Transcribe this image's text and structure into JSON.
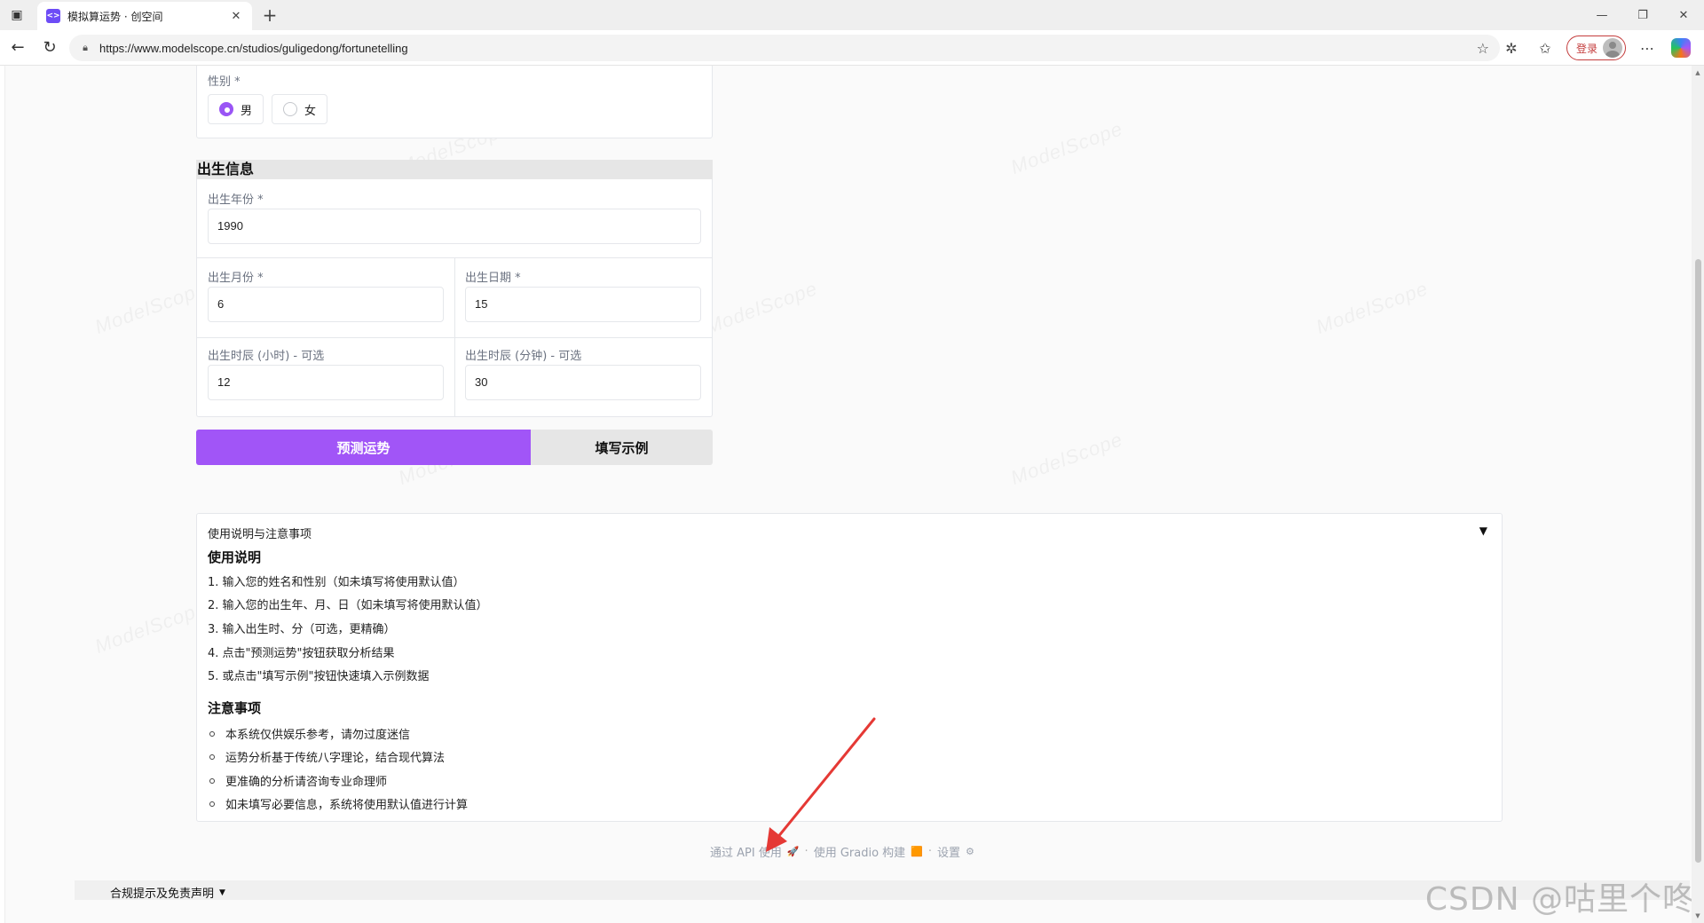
{
  "browser": {
    "tab_title": "模拟算运势 · 创空间",
    "tab_favicon_text": "<>",
    "new_tab_label": "+",
    "url": "https://www.modelscope.cn/studios/guligedong/fortunetelling",
    "login_label": "登录"
  },
  "watermark_text": "ModelScope",
  "gender": {
    "label": "性别 *",
    "options": [
      "男",
      "女"
    ],
    "selected": "男"
  },
  "birth": {
    "section_title": "出生信息",
    "year_label": "出生年份 *",
    "year_value": "1990",
    "month_label": "出生月份 *",
    "month_value": "6",
    "day_label": "出生日期 *",
    "day_value": "15",
    "hour_label": "出生时辰 (小时) - 可选",
    "hour_value": "12",
    "minute_label": "出生时辰 (分钟) - 可选",
    "minute_value": "30"
  },
  "buttons": {
    "predict": "预测运势",
    "example": "填写示例"
  },
  "instructions": {
    "accordion_title": "使用说明与注意事项",
    "usage_heading": "使用说明",
    "usage_items": [
      "1. 输入您的姓名和性别（如未填写将使用默认值）",
      "2. 输入您的出生年、月、日（如未填写将使用默认值）",
      "3. 输入出生时、分（可选，更精确）",
      "4. 点击\"预测运势\"按钮获取分析结果",
      "5. 或点击\"填写示例\"按钮快速填入示例数据"
    ],
    "notes_heading": "注意事项",
    "notes_items": [
      "本系统仅供娱乐参考，请勿过度迷信",
      "运势分析基于传统八字理论，结合现代算法",
      "更准确的分析请咨询专业命理师",
      "如未填写必要信息，系统将使用默认值进行计算"
    ]
  },
  "footer": {
    "api_link": "通过 API 使用",
    "gradio_link": "使用 Gradio 构建",
    "settings_link": "设置",
    "separator": "·"
  },
  "disclaimer": "合规提示及免责声明",
  "overlay_watermark": "CSDN @咕里个咚",
  "colors": {
    "accent": "#a155f7",
    "annotation_arrow": "#e53935"
  }
}
